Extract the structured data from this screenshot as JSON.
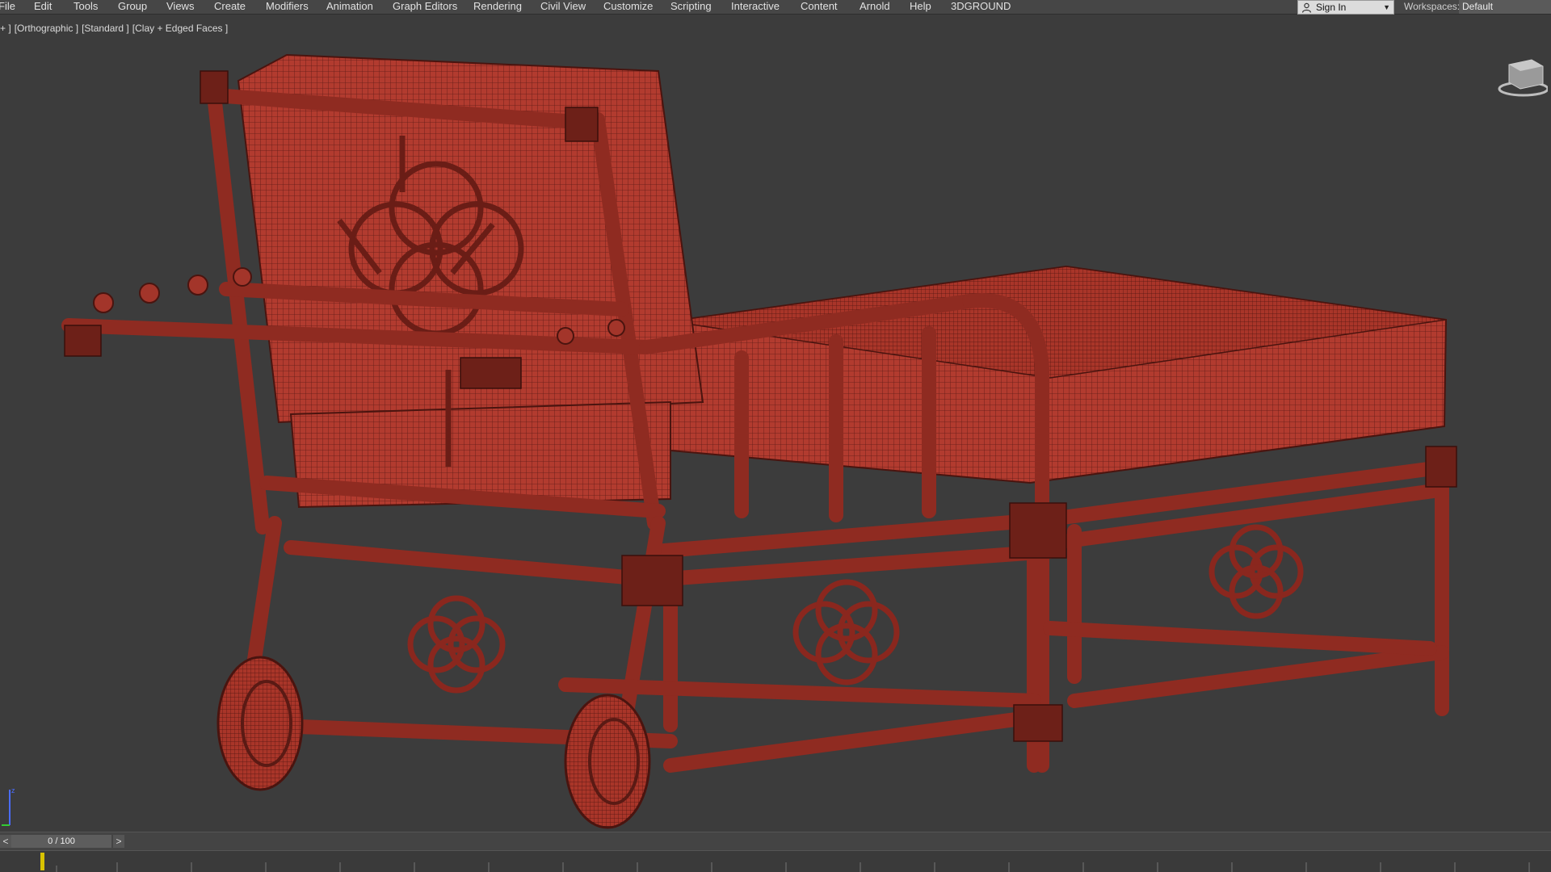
{
  "menubar": {
    "items": [
      "File",
      "Edit",
      "Tools",
      "Group",
      "Views",
      "Create",
      "Modifiers",
      "Animation",
      "Graph Editors",
      "Rendering",
      "Civil View",
      "Customize",
      "Scripting",
      "Interactive",
      "Content",
      "Arnold",
      "Help",
      "3DGROUND"
    ],
    "sign_in_label": "Sign In",
    "workspaces_label": "Workspaces:",
    "workspace_value": "Default"
  },
  "viewport": {
    "labels": [
      "+ ]",
      "[Orthographic ]",
      "[Standard ]",
      "[Clay + Edged Faces ]"
    ],
    "mesh_color": "#b03a2e",
    "wire_color": "#5a1a14",
    "background": "#3c3c3c"
  },
  "timeline": {
    "frame_display": "0 / 100",
    "prev_label": "<",
    "next_label": ">"
  }
}
